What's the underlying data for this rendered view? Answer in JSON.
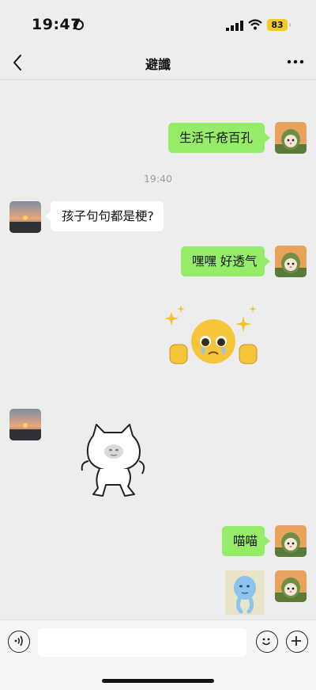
{
  "status_bar": {
    "time": "19:47",
    "battery": "83"
  },
  "nav": {
    "title": "避讖",
    "back_icon": "chevron-left-icon",
    "more_icon": "ellipsis-icon"
  },
  "chat": {
    "timestamp": "19:40",
    "messages": [
      {
        "from": "me",
        "text": "生活千疮百孔"
      },
      {
        "from": "other",
        "text": "孩子句句都是梗?"
      },
      {
        "from": "me",
        "text": "嘿嘿 好透气"
      },
      {
        "from": "me",
        "type": "sticker",
        "sticker": "pleading-face-sparkles-sticker"
      },
      {
        "from": "other",
        "type": "sticker",
        "sticker": "white-cat-dancing-sticker"
      },
      {
        "from": "me",
        "text": "喵喵"
      },
      {
        "from": "me",
        "type": "sticker",
        "sticker": "blue-figure-sticker"
      }
    ]
  },
  "colors": {
    "my_bubble": "#95ec69",
    "other_bubble": "#ffffff",
    "background": "#ededed",
    "battery": "#f4cc1f"
  },
  "input_bar": {
    "voice_icon": "voice-icon",
    "emoji_icon": "emoji-icon",
    "plus_icon": "plus-icon"
  }
}
